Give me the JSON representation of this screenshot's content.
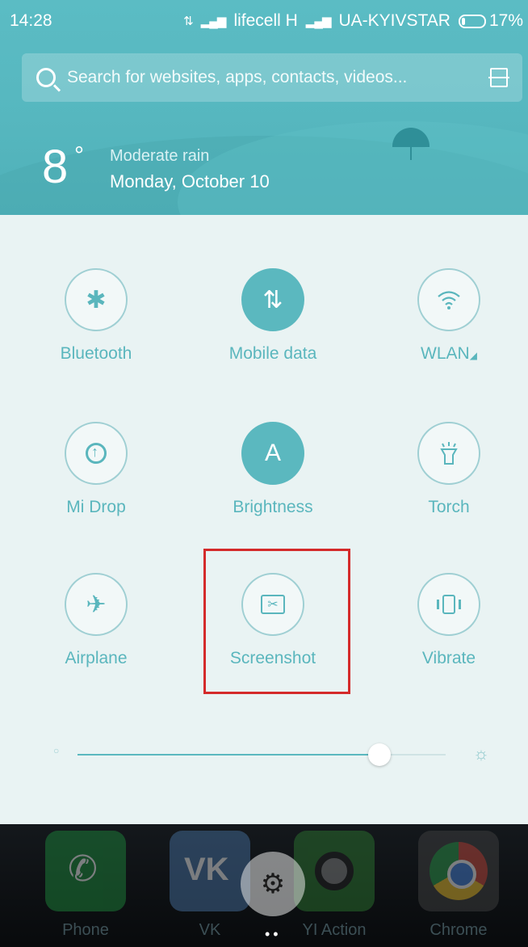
{
  "status_bar": {
    "time": "14:28",
    "carrier1": "lifecell H",
    "carrier2": "UA-KYIVSTAR",
    "battery": "17%"
  },
  "search": {
    "placeholder": "Search for websites, apps, contacts, videos..."
  },
  "weather": {
    "temperature": "8",
    "degree_symbol": "°",
    "condition": "Moderate rain",
    "date": "Monday, October 10"
  },
  "toggles": [
    {
      "label": "Bluetooth",
      "icon": "bluetooth-icon",
      "state": "off"
    },
    {
      "label": "Mobile data",
      "icon": "mobile-data-icon",
      "state": "on"
    },
    {
      "label": "WLAN",
      "icon": "wifi-icon",
      "state": "off"
    },
    {
      "label": "Mi Drop",
      "icon": "mi-drop-icon",
      "state": "off"
    },
    {
      "label": "Brightness",
      "icon": "brightness-auto-icon",
      "state": "on",
      "glyph": "A"
    },
    {
      "label": "Torch",
      "icon": "torch-icon",
      "state": "off"
    },
    {
      "label": "Airplane",
      "icon": "airplane-icon",
      "state": "off"
    },
    {
      "label": "Screenshot",
      "icon": "screenshot-icon",
      "state": "off"
    },
    {
      "label": "Vibrate",
      "icon": "vibrate-icon",
      "state": "off"
    }
  ],
  "brightness_slider": {
    "level": 0.82
  },
  "dock_apps": [
    {
      "label": "Phone",
      "icon": "phone-icon"
    },
    {
      "label": "VK",
      "icon": "vk-icon"
    },
    {
      "label": "YI Action",
      "icon": "yi-action-icon"
    },
    {
      "label": "Chrome",
      "icon": "chrome-icon"
    }
  ],
  "colors": {
    "accent": "#5bb8bf",
    "highlight": "#d42a2a"
  }
}
